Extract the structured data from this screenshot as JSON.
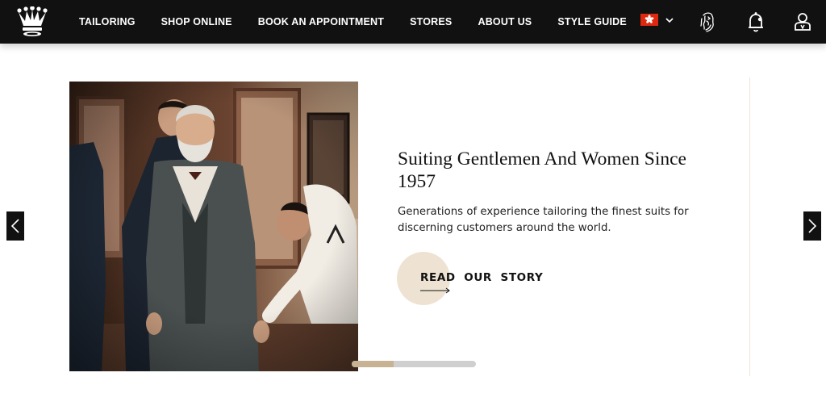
{
  "nav": {
    "items": [
      "TAILORING",
      "SHOP ONLINE",
      "BOOK AN APPOINTMENT",
      "STORES",
      "ABOUT US",
      "STYLE GUIDE"
    ]
  },
  "header_icons": [
    "crown-logo-icon",
    "hong-kong-flag-icon",
    "chevron-down-icon",
    "lion-crest-icon",
    "notification-bell-icon",
    "account-icon"
  ],
  "hero": {
    "headline": "Suiting Gentlemen And Women Since 1957",
    "subtext": "Generations of experience tailoring the finest suits for discerning customers around the world.",
    "cta_label": "READ  OUR  STORY",
    "progress": 0.34
  },
  "colors": {
    "header_bg": "#111111",
    "cta_circle": "#eee3d2",
    "progress_fill": "#c7b393",
    "progress_track": "#cfcfcf",
    "flag_red": "#de2910"
  }
}
